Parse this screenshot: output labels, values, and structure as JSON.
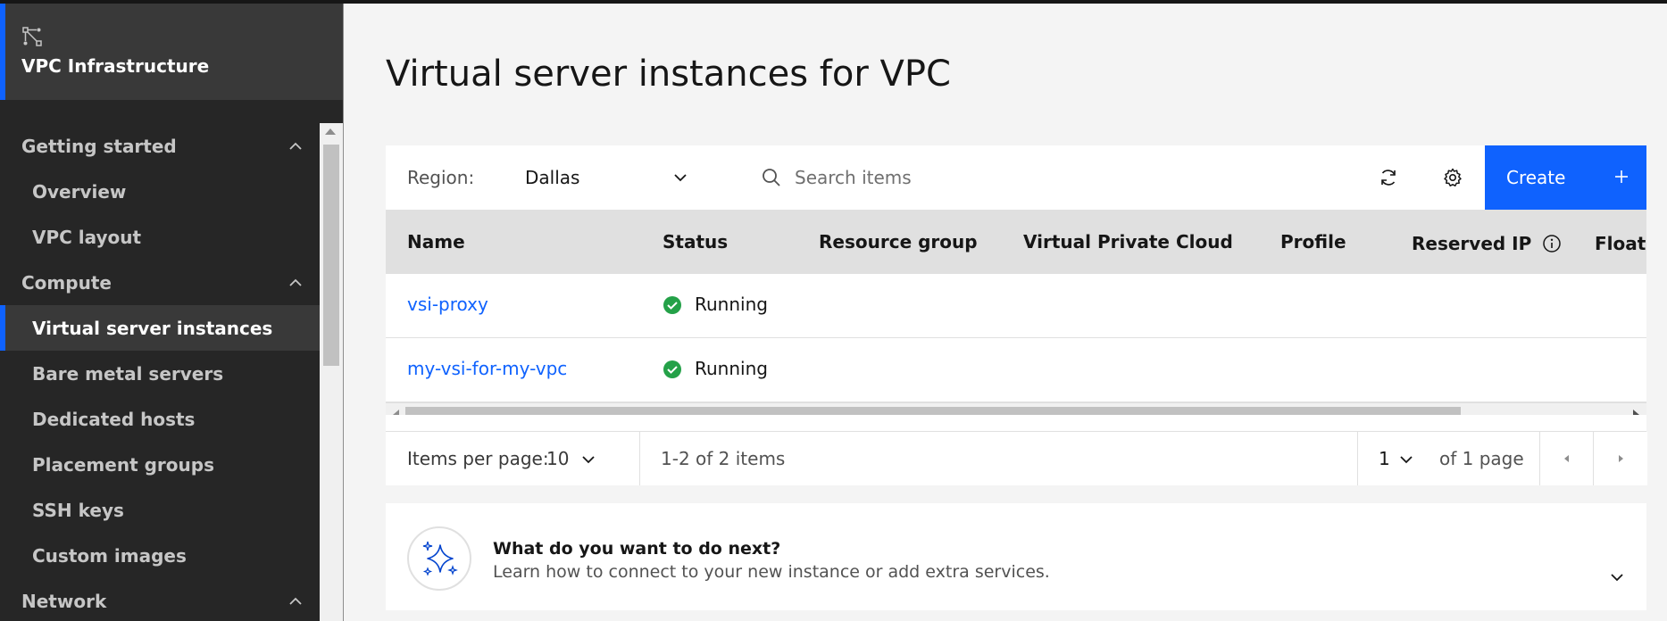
{
  "sidebar": {
    "title": "VPC Infrastructure",
    "logo_icon": "network-logo-icon",
    "sections": [
      {
        "label": "Getting started",
        "expanded": true,
        "items": [
          {
            "label": "Overview"
          },
          {
            "label": "VPC layout"
          }
        ]
      },
      {
        "label": "Compute",
        "expanded": true,
        "items": [
          {
            "label": "Virtual server instances",
            "active": true
          },
          {
            "label": "Bare metal servers"
          },
          {
            "label": "Dedicated hosts"
          },
          {
            "label": "Placement groups"
          },
          {
            "label": "SSH keys"
          },
          {
            "label": "Custom images"
          }
        ]
      },
      {
        "label": "Network",
        "expanded": true,
        "items": []
      }
    ]
  },
  "main": {
    "title": "Virtual server instances for VPC",
    "toolbar": {
      "region_label": "Region:",
      "region_value": "Dallas",
      "search_placeholder": "Search items",
      "refresh_icon": "refresh-icon",
      "settings_icon": "gear-icon",
      "create_label": "Create",
      "create_icon": "plus-icon"
    },
    "table": {
      "columns": [
        {
          "label": "Name"
        },
        {
          "label": "Status"
        },
        {
          "label": "Resource group"
        },
        {
          "label": "Virtual Private Cloud"
        },
        {
          "label": "Profile"
        },
        {
          "label": "Reserved IP",
          "info": true
        },
        {
          "label": "Floatin"
        }
      ],
      "rows": [
        {
          "name": "vsi-proxy",
          "status": "Running"
        },
        {
          "name": "my-vsi-for-my-vpc",
          "status": "Running"
        }
      ]
    },
    "pagination": {
      "items_per_page_label": "Items per page:",
      "items_per_page_value": "10",
      "range_text": "1-2 of 2 items",
      "page_value": "1",
      "page_total_text": "of 1 page"
    },
    "next_steps": {
      "title": "What do you want to do next?",
      "subtitle": "Learn how to connect to your new instance or add extra services."
    }
  },
  "colors": {
    "accent": "#0f62fe",
    "success": "#24a148",
    "sidebar_bg": "#262626"
  }
}
